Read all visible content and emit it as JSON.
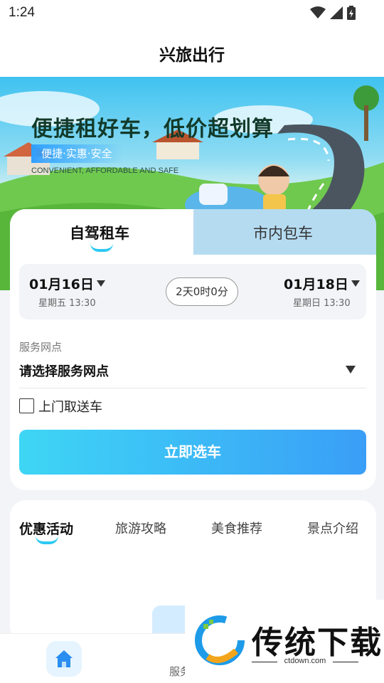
{
  "status_bar": {
    "time": "1:24"
  },
  "header": {
    "title": "兴旅出行"
  },
  "banner": {
    "headline": "便捷租好车，低价超划算",
    "tags": "便捷·实惠·安全",
    "english": "CONVENIENT, AFFORDABLE AND SAFE"
  },
  "booking": {
    "tabs": [
      {
        "label": "自驾租车",
        "active": true
      },
      {
        "label": "市内包车",
        "active": false
      }
    ],
    "pickup": {
      "date": "01月16日",
      "sub": "星期五 13:30"
    },
    "return": {
      "date": "01月18日",
      "sub": "星期日 13:30"
    },
    "duration": "2天0时0分",
    "outlet": {
      "label": "服务网点",
      "placeholder": "请选择服务网点"
    },
    "delivery": {
      "label": "上门取送车",
      "checked": false
    },
    "submit_label": "立即选车"
  },
  "info_tabs": [
    {
      "label": "优惠活动",
      "active": true
    },
    {
      "label": "旅游攻略",
      "active": false
    },
    {
      "label": "美食推荐",
      "active": false
    },
    {
      "label": "景点介绍",
      "active": false
    }
  ],
  "bottom_nav": {
    "items": [
      {
        "icon": "home-icon",
        "label": "",
        "active": true
      },
      {
        "icon": "service-icon",
        "label": "服务",
        "active": false
      }
    ]
  },
  "watermark": {
    "text": "传统下载",
    "url": "ctdown.com"
  },
  "colors": {
    "accent": "#2cc9f2",
    "button_start": "#3ed6f5",
    "button_end": "#3a9ef7"
  }
}
